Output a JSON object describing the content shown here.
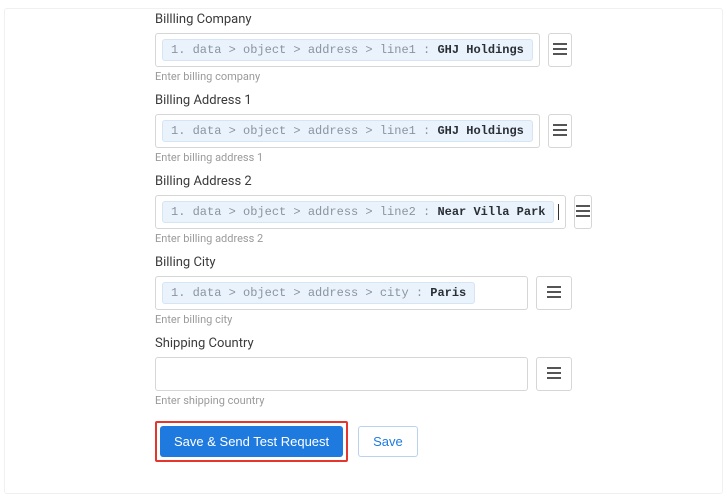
{
  "fields": {
    "billing_company": {
      "label": "Billling Company",
      "chip_path": "1. data > object > address > line1 :",
      "chip_value": "GHJ Holdings",
      "hint": "Enter billing company"
    },
    "billing_address_1": {
      "label": "Billing Address 1",
      "chip_path": "1. data > object > address > line1 :",
      "chip_value": "GHJ Holdings",
      "hint": "Enter billing address 1"
    },
    "billing_address_2": {
      "label": "Billing Address 2",
      "chip_path": "1. data > object > address > line2 :",
      "chip_value": "Near Villa Park",
      "hint": "Enter billing address 2"
    },
    "billing_city": {
      "label": "Billing City",
      "chip_path": "1. data > object > address > city :",
      "chip_value": "Paris",
      "hint": "Enter billing city"
    },
    "shipping_country": {
      "label": "Shipping Country",
      "hint": "Enter shipping country"
    }
  },
  "buttons": {
    "save_send": "Save & Send Test Request",
    "save": "Save"
  }
}
